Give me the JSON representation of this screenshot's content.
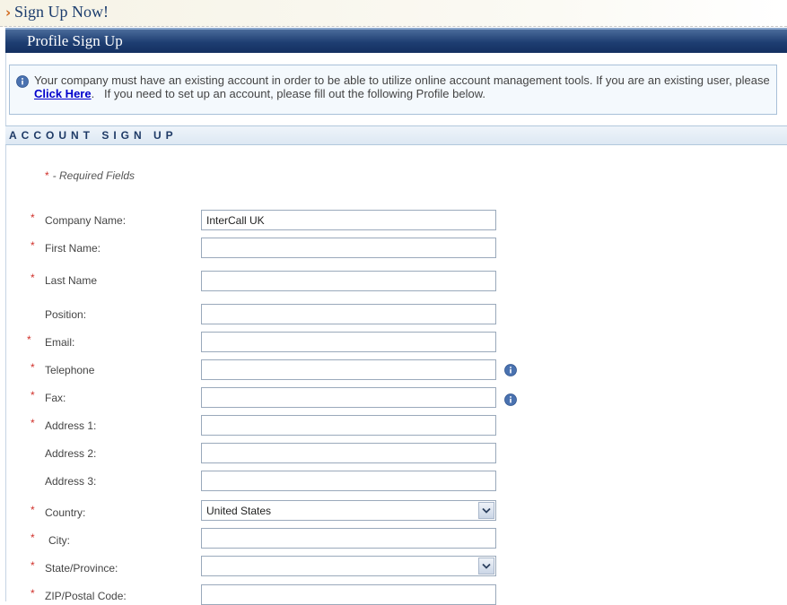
{
  "header": {
    "title": "Sign Up Now!",
    "arrow": "›"
  },
  "profile_bar": {
    "title": "Profile Sign Up"
  },
  "info": {
    "text_before": "Your company must have an existing account in order to be able to utilize online account management tools. If you are an existing user, please ",
    "link": "Click Here",
    "text_after": ".   If you need to set up an account, please fill out the following Profile below."
  },
  "section": {
    "title": "ACCOUNT SIGN UP"
  },
  "required_note": {
    "star": "*",
    "text": "- Required Fields"
  },
  "form": {
    "company_name": {
      "label": "Company Name:",
      "value": "InterCall UK"
    },
    "first_name": {
      "label": "First Name:",
      "value": ""
    },
    "last_name": {
      "label": "Last Name",
      "value": ""
    },
    "position": {
      "label": "Position:",
      "value": ""
    },
    "email": {
      "label": "Email:",
      "value": ""
    },
    "telephone": {
      "label": "Telephone",
      "value": ""
    },
    "fax": {
      "label": "Fax:",
      "value": ""
    },
    "address1": {
      "label": "Address 1:",
      "value": ""
    },
    "address2": {
      "label": "Address 2:",
      "value": ""
    },
    "address3": {
      "label": "Address 3:",
      "value": ""
    },
    "country": {
      "label": "Country:",
      "value": "United States"
    },
    "city": {
      "label": "City:",
      "value": ""
    },
    "state": {
      "label": "State/Province:",
      "value": ""
    },
    "zip": {
      "label": "ZIP/Postal Code:",
      "value": ""
    }
  },
  "required_star": "*",
  "colors": {
    "accent_blue": "#1e3e72",
    "required_red": "#d0302a",
    "link_blue": "#0000cc"
  },
  "icons": {
    "info": "info-icon",
    "dropdown": "chevron-down-icon"
  }
}
